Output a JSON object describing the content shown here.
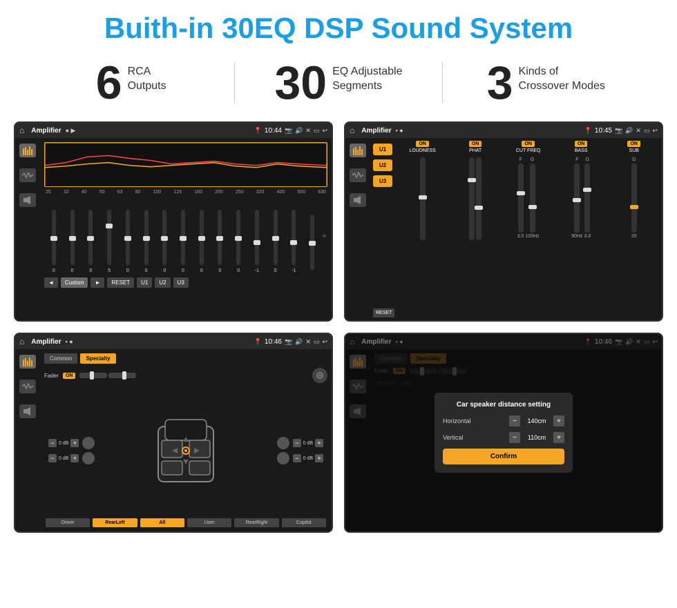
{
  "header": {
    "title": "Buith-in 30EQ DSP Sound System"
  },
  "stats": [
    {
      "number": "6",
      "label": "RCA\nOutputs"
    },
    {
      "number": "30",
      "label": "EQ Adjustable\nSegments"
    },
    {
      "number": "3",
      "label": "Kinds of\nCrossover Modes"
    }
  ],
  "screens": [
    {
      "id": "screen1",
      "topbar": {
        "title": "Amplifier",
        "time": "10:44"
      },
      "type": "eq"
    },
    {
      "id": "screen2",
      "topbar": {
        "title": "Amplifier",
        "time": "10:45"
      },
      "type": "crossover"
    },
    {
      "id": "screen3",
      "topbar": {
        "title": "Amplifier",
        "time": "10:46"
      },
      "type": "fader"
    },
    {
      "id": "screen4",
      "topbar": {
        "title": "Amplifier",
        "time": "10:46"
      },
      "type": "dialog"
    }
  ],
  "eq": {
    "freqs": [
      "25",
      "32",
      "40",
      "50",
      "63",
      "80",
      "100",
      "125",
      "160",
      "200",
      "250",
      "320",
      "400",
      "500",
      "630"
    ],
    "values": [
      "0",
      "0",
      "0",
      "5",
      "0",
      "0",
      "0",
      "0",
      "0",
      "0",
      "0",
      "-1",
      "0",
      "-1",
      ""
    ],
    "buttons": [
      "◄",
      "Custom",
      "►",
      "RESET",
      "U1",
      "U2",
      "U3"
    ]
  },
  "crossover": {
    "presets": [
      "U1",
      "U2",
      "U3"
    ],
    "channels": [
      {
        "label": "LOUDNESS",
        "on": true
      },
      {
        "label": "PHAT",
        "on": true
      },
      {
        "label": "CUT FREQ",
        "on": true
      },
      {
        "label": "BASS",
        "on": true
      },
      {
        "label": "SUB",
        "on": true
      }
    ],
    "reset": "RESET"
  },
  "fader": {
    "tabs": [
      "Common",
      "Specialty"
    ],
    "fader_label": "Fader",
    "on_label": "ON",
    "controls_left": [
      "0 dB",
      "0 dB"
    ],
    "controls_right": [
      "0 dB",
      "0 dB"
    ],
    "bottom_buttons": [
      "Driver",
      "RearLeft",
      "All",
      "User",
      "RearRight",
      "Copilot"
    ]
  },
  "dialog": {
    "title": "Car speaker distance setting",
    "horizontal_label": "Horizontal",
    "horizontal_value": "140cm",
    "vertical_label": "Vertical",
    "vertical_value": "110cm",
    "confirm_label": "Confirm"
  }
}
